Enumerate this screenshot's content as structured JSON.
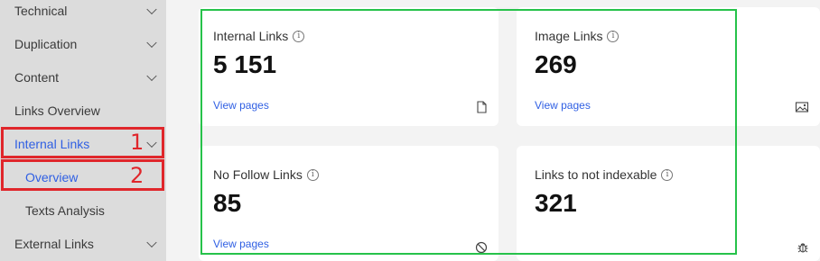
{
  "sidebar": {
    "items": [
      {
        "label": "Technical"
      },
      {
        "label": "Duplication"
      },
      {
        "label": "Content"
      },
      {
        "label": "Links Overview"
      },
      {
        "label": "Internal Links"
      },
      {
        "label": "Overview"
      },
      {
        "label": "Texts Analysis"
      },
      {
        "label": "External Links"
      }
    ]
  },
  "annotations": {
    "marker_1": "1",
    "marker_2": "2"
  },
  "cards": [
    {
      "title": "Internal Links",
      "value": "5 151",
      "link": "View pages",
      "icon": "page-icon"
    },
    {
      "title": "Image Links",
      "value": "269",
      "link": "View pages",
      "icon": "image-icon"
    },
    {
      "title": "No Follow Links",
      "value": "85",
      "link": "View pages",
      "icon": "no-entry-icon"
    },
    {
      "title": "Links to not indexable",
      "value": "321",
      "link": "",
      "icon": "bug-icon"
    }
  ],
  "colors": {
    "accent": "#2f5fe3",
    "annotation_red": "#e0262b",
    "highlight_green": "#26c24a"
  }
}
